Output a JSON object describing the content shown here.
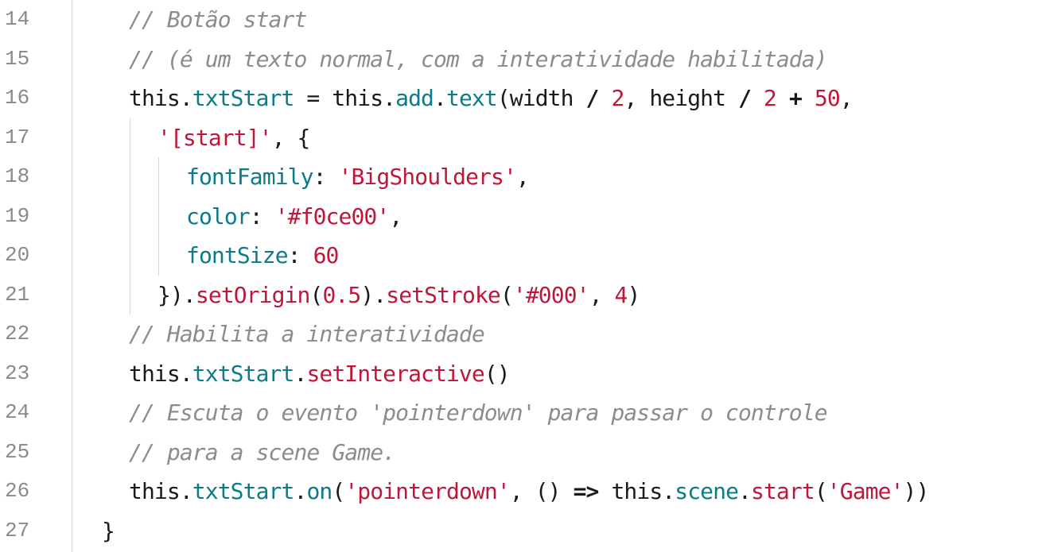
{
  "editor": {
    "lines": [
      {
        "number": "14",
        "indent": 1,
        "tokens": [
          {
            "type": "cmt",
            "text": "// Botão start"
          }
        ]
      },
      {
        "number": "15",
        "indent": 1,
        "tokens": [
          {
            "type": "cmt",
            "text": "// (é um texto normal, com a interatividade habilitada)"
          }
        ]
      },
      {
        "number": "16",
        "indent": 1,
        "tokens": [
          {
            "type": "plain",
            "text": "this."
          },
          {
            "type": "prop",
            "text": "txtStart"
          },
          {
            "type": "plain",
            "text": " = this."
          },
          {
            "type": "prop",
            "text": "add"
          },
          {
            "type": "plain",
            "text": "."
          },
          {
            "type": "prop",
            "text": "text"
          },
          {
            "type": "plain",
            "text": "(width "
          },
          {
            "type": "op",
            "text": "/"
          },
          {
            "type": "plain",
            "text": " "
          },
          {
            "type": "num",
            "text": "2"
          },
          {
            "type": "plain",
            "text": ", height "
          },
          {
            "type": "op",
            "text": "/"
          },
          {
            "type": "plain",
            "text": " "
          },
          {
            "type": "num",
            "text": "2"
          },
          {
            "type": "plain",
            "text": " "
          },
          {
            "type": "op",
            "text": "+"
          },
          {
            "type": "plain",
            "text": " "
          },
          {
            "type": "num",
            "text": "50"
          },
          {
            "type": "plain",
            "text": ","
          }
        ]
      },
      {
        "number": "17",
        "indent": 2,
        "tokens": [
          {
            "type": "str",
            "text": "'[start]'"
          },
          {
            "type": "plain",
            "text": ", {"
          }
        ]
      },
      {
        "number": "18",
        "indent": 3,
        "tokens": [
          {
            "type": "prop",
            "text": "fontFamily"
          },
          {
            "type": "plain",
            "text": ": "
          },
          {
            "type": "str",
            "text": "'BigShoulders'"
          },
          {
            "type": "plain",
            "text": ","
          }
        ]
      },
      {
        "number": "19",
        "indent": 3,
        "tokens": [
          {
            "type": "prop",
            "text": "color"
          },
          {
            "type": "plain",
            "text": ": "
          },
          {
            "type": "str",
            "text": "'#f0ce00'"
          },
          {
            "type": "plain",
            "text": ","
          }
        ]
      },
      {
        "number": "20",
        "indent": 3,
        "tokens": [
          {
            "type": "prop",
            "text": "fontSize"
          },
          {
            "type": "plain",
            "text": ": "
          },
          {
            "type": "num",
            "text": "60"
          }
        ]
      },
      {
        "number": "21",
        "indent": 2,
        "tokens": [
          {
            "type": "plain",
            "text": "})."
          },
          {
            "type": "str",
            "text": "setOrigin"
          },
          {
            "type": "plain",
            "text": "("
          },
          {
            "type": "num",
            "text": "0.5"
          },
          {
            "type": "plain",
            "text": ")."
          },
          {
            "type": "str",
            "text": "setStroke"
          },
          {
            "type": "plain",
            "text": "("
          },
          {
            "type": "str",
            "text": "'#000'"
          },
          {
            "type": "plain",
            "text": ", "
          },
          {
            "type": "num",
            "text": "4"
          },
          {
            "type": "plain",
            "text": ")"
          }
        ]
      },
      {
        "number": "22",
        "indent": 1,
        "tokens": [
          {
            "type": "cmt",
            "text": "// Habilita a interatividade"
          }
        ]
      },
      {
        "number": "23",
        "indent": 1,
        "tokens": [
          {
            "type": "plain",
            "text": "this."
          },
          {
            "type": "prop",
            "text": "txtStart"
          },
          {
            "type": "plain",
            "text": "."
          },
          {
            "type": "str",
            "text": "setInteractive"
          },
          {
            "type": "plain",
            "text": "()"
          }
        ]
      },
      {
        "number": "24",
        "indent": 1,
        "tokens": [
          {
            "type": "cmt",
            "text": "// Escuta o evento 'pointerdown' para passar o controle"
          }
        ]
      },
      {
        "number": "25",
        "indent": 1,
        "tokens": [
          {
            "type": "cmt",
            "text": "// para a scene Game."
          }
        ]
      },
      {
        "number": "26",
        "indent": 1,
        "tokens": [
          {
            "type": "plain",
            "text": "this."
          },
          {
            "type": "prop",
            "text": "txtStart"
          },
          {
            "type": "plain",
            "text": "."
          },
          {
            "type": "prop",
            "text": "on"
          },
          {
            "type": "plain",
            "text": "("
          },
          {
            "type": "str",
            "text": "'pointerdown'"
          },
          {
            "type": "plain",
            "text": ", () "
          },
          {
            "type": "op",
            "text": "=>"
          },
          {
            "type": "plain",
            "text": " this."
          },
          {
            "type": "prop",
            "text": "scene"
          },
          {
            "type": "plain",
            "text": "."
          },
          {
            "type": "str",
            "text": "start"
          },
          {
            "type": "plain",
            "text": "("
          },
          {
            "type": "str",
            "text": "'Game'"
          },
          {
            "type": "plain",
            "text": "))"
          }
        ]
      },
      {
        "number": "27",
        "indent": 0,
        "tokens": [
          {
            "type": "plain",
            "text": "}"
          }
        ]
      }
    ]
  }
}
